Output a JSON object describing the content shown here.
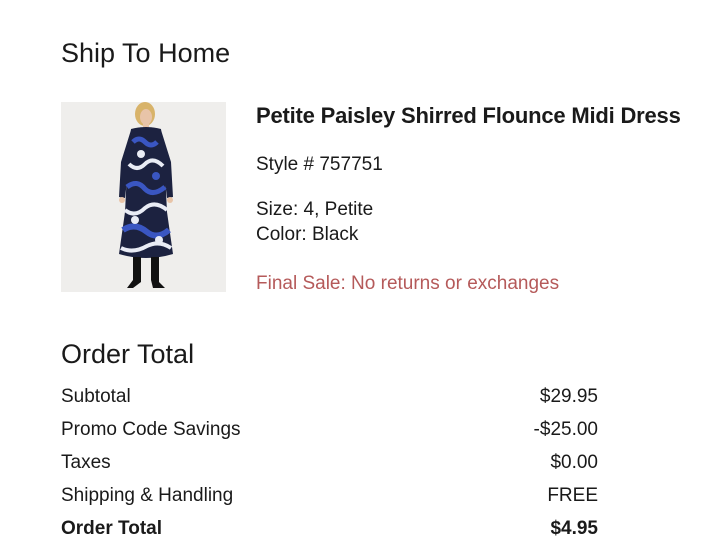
{
  "shipping_section": {
    "title": "Ship To Home"
  },
  "product": {
    "name": "Petite Paisley Shirred Flounce Midi Dress",
    "style": "Style # 757751",
    "size": "Size: 4, Petite",
    "color": "Color: Black",
    "final_sale": "Final Sale: No returns or exchanges",
    "image_icon": "dress-photo",
    "final_sale_color": "#b55a5a"
  },
  "order_total_section": {
    "title": "Order Total",
    "rows": [
      {
        "label": "Subtotal",
        "value": "$29.95"
      },
      {
        "label": "Promo Code Savings",
        "value": "-$25.00"
      },
      {
        "label": "Taxes",
        "value": "$0.00"
      },
      {
        "label": "Shipping & Handling",
        "value": "FREE"
      },
      {
        "label": "Order Total",
        "value": "$4.95"
      }
    ]
  }
}
